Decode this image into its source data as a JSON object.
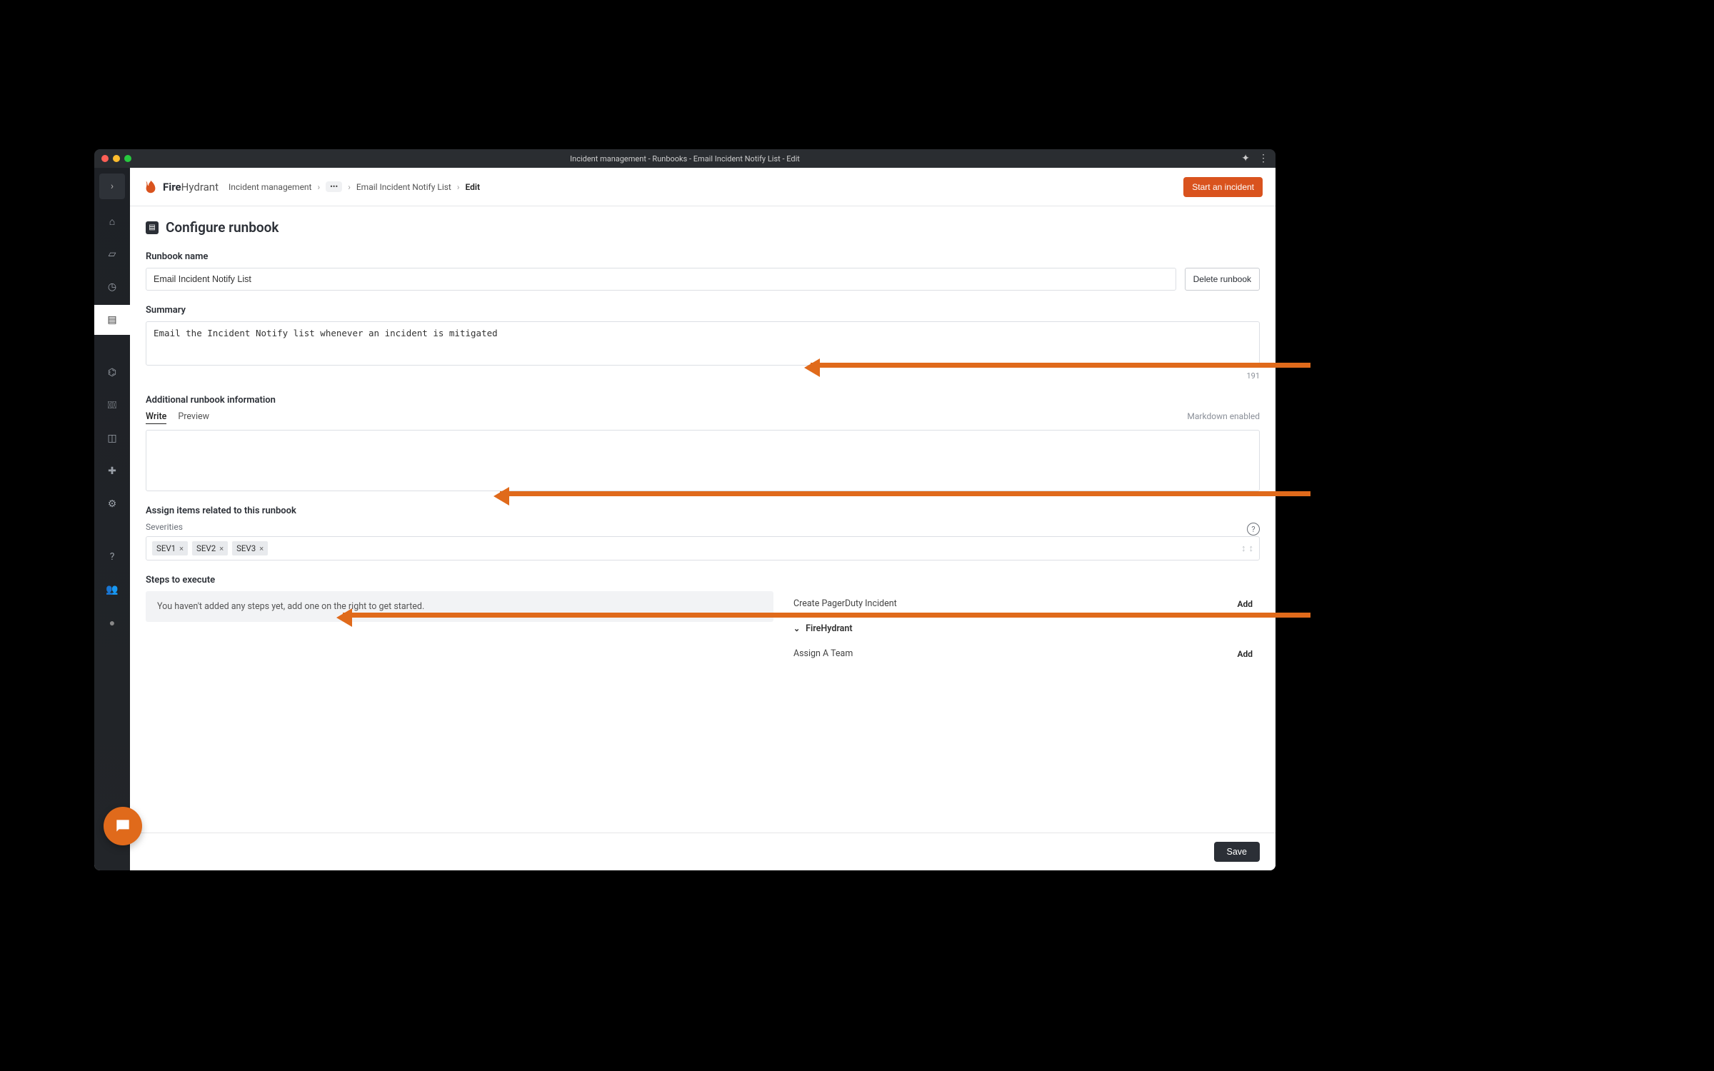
{
  "titlebar": {
    "title": "Incident management - Runbooks - Email Incident Notify List - Edit"
  },
  "logo": {
    "brand_a": "Fire",
    "brand_b": "Hydrant"
  },
  "breadcrumb": {
    "a": "Incident management",
    "more": "•••",
    "b": "Email Incident Notify List",
    "c": "Edit"
  },
  "topbar": {
    "cta": "Start an incident"
  },
  "page": {
    "title": "Configure runbook",
    "name_label": "Runbook name",
    "name_value": "Email Incident Notify List",
    "delete_label": "Delete runbook",
    "summary_label": "Summary",
    "summary_value": "Email the Incident Notify list whenever an incident is mitigated",
    "summary_remaining": "191",
    "addl_label": "Additional runbook information",
    "tab_write": "Write",
    "tab_preview": "Preview",
    "md_hint": "Markdown enabled",
    "assign_label": "Assign items related to this runbook",
    "severities_label": "Severities",
    "severities": [
      "SEV1",
      "SEV2",
      "SEV3"
    ],
    "steps_label": "Steps to execute",
    "steps_empty": "You haven't added any steps yet, add one on the right to get started.",
    "right": {
      "pd": "Create PagerDuty Incident",
      "group": "FireHydrant",
      "team": "Assign A Team",
      "add": "Add"
    },
    "save": "Save"
  }
}
